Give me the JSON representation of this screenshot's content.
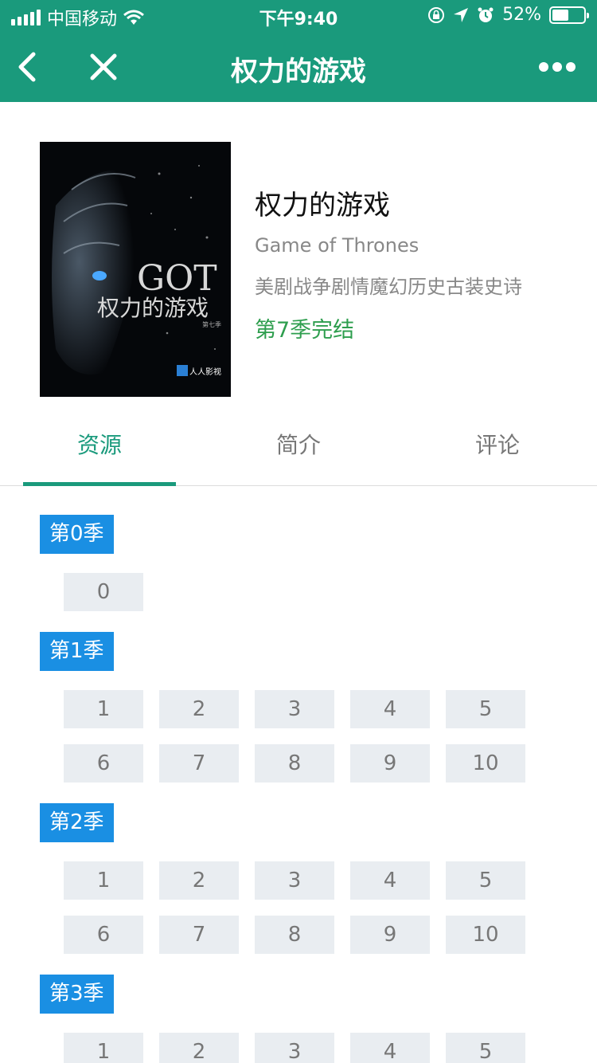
{
  "status_bar": {
    "carrier": "中国移动",
    "time": "下午9:40",
    "battery_text": "52%",
    "battery_level": 0.52,
    "icons": [
      "signal-icon",
      "wifi-icon",
      "orientation-lock-icon",
      "location-arrow-icon",
      "alarm-icon",
      "battery-icon"
    ]
  },
  "nav": {
    "title": "权力的游戏",
    "icons": [
      "back-chevron-icon",
      "close-icon",
      "more-dots-icon"
    ]
  },
  "show": {
    "title": "权力的游戏",
    "english_title": "Game of Thrones",
    "genres": "美剧战争剧情魔幻历史古装史诗",
    "status": "第7季完结",
    "poster": {
      "logo_text": "GOT",
      "title_text": "权力的游戏",
      "small_text": "第七季",
      "badge_text": "人人影视"
    }
  },
  "tabs": [
    {
      "label": "资源",
      "active": true
    },
    {
      "label": "简介",
      "active": false
    },
    {
      "label": "评论",
      "active": false
    }
  ],
  "seasons": [
    {
      "label": "第0季",
      "episodes": [
        "0"
      ]
    },
    {
      "label": "第1季",
      "episodes": [
        "1",
        "2",
        "3",
        "4",
        "5",
        "6",
        "7",
        "8",
        "9",
        "10"
      ]
    },
    {
      "label": "第2季",
      "episodes": [
        "1",
        "2",
        "3",
        "4",
        "5",
        "6",
        "7",
        "8",
        "9",
        "10"
      ]
    },
    {
      "label": "第3季",
      "episodes": [
        "1",
        "2",
        "3",
        "4",
        "5"
      ]
    }
  ],
  "colors": {
    "header_green": "#1a9a7c",
    "season_blue": "#1a8fe3",
    "status_green": "#2e9e4e",
    "episode_bg": "#e9edf1"
  }
}
